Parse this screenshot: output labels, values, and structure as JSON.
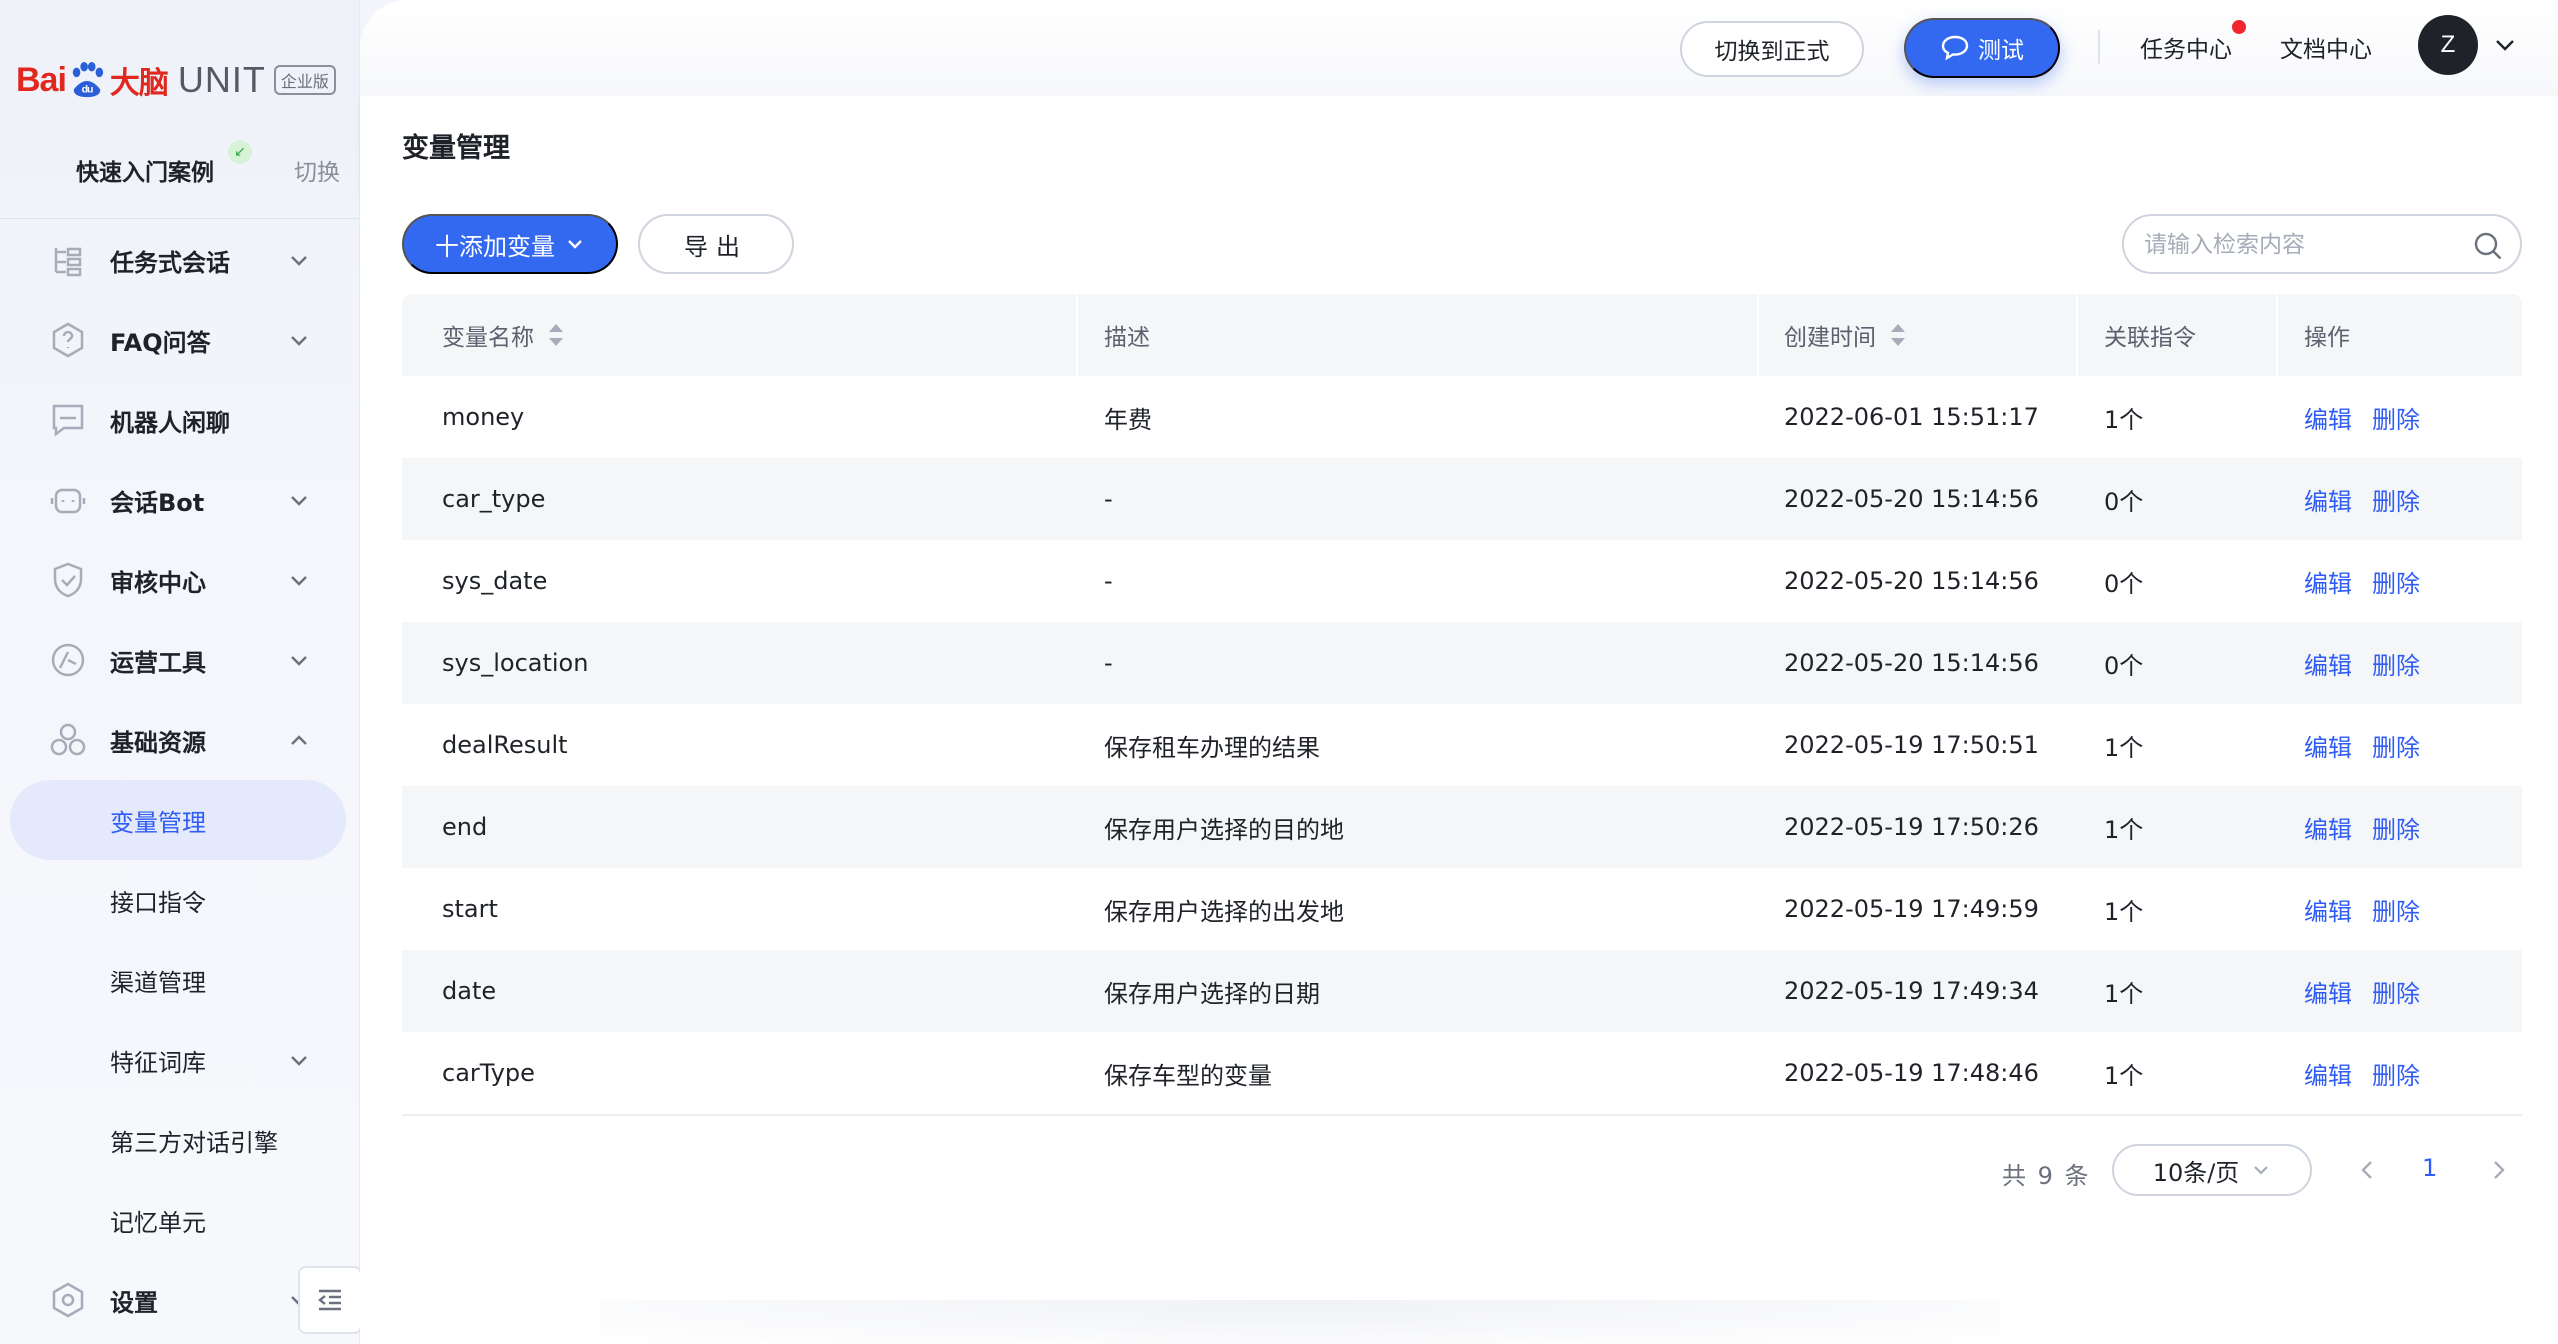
{
  "brand": {
    "baidu": "Bai",
    "du": "du",
    "dana": "大脑",
    "unit": "UNIT",
    "edition": "企业版"
  },
  "project": {
    "name": "快速入门案例",
    "switch_label": "切换"
  },
  "sidebar": {
    "items": [
      {
        "label": "任务式会话",
        "icon": "task-dialog-icon",
        "chevron": "down"
      },
      {
        "label": "FAQ问答",
        "icon": "faq-icon",
        "chevron": "down"
      },
      {
        "label": "机器人闲聊",
        "icon": "chat-icon",
        "chevron": ""
      },
      {
        "label": "会话Bot",
        "icon": "bot-icon",
        "chevron": "down"
      },
      {
        "label": "审核中心",
        "icon": "shield-icon",
        "chevron": "down"
      },
      {
        "label": "运营工具",
        "icon": "operations-icon",
        "chevron": "down"
      },
      {
        "label": "基础资源",
        "icon": "resources-icon",
        "chevron": "up"
      },
      {
        "label": "变量管理",
        "sub": true,
        "active": true
      },
      {
        "label": "接口指令",
        "sub": true
      },
      {
        "label": "渠道管理",
        "sub": true
      },
      {
        "label": "特征词库",
        "sub": true,
        "chevron": "down"
      },
      {
        "label": "第三方对话引擎",
        "sub": true
      },
      {
        "label": "记忆单元",
        "sub": true
      },
      {
        "label": "设置",
        "icon": "settings-icon",
        "chevron": "down"
      }
    ]
  },
  "header": {
    "switch_label": "切换到正式",
    "test_label": "测试",
    "task_center": "任务中心",
    "doc_center": "文档中心",
    "avatar_letter": "Z"
  },
  "page": {
    "title": "变量管理"
  },
  "toolbar": {
    "add_label": "十添加变量",
    "export_label": "导出",
    "search_placeholder": "请输入检索内容"
  },
  "table": {
    "columns": [
      "变量名称",
      "描述",
      "创建时间",
      "关联指令",
      "操作"
    ],
    "rows": [
      {
        "name": "money",
        "desc": "年费",
        "created": "2022-06-01 15:51:17",
        "linked": "1个"
      },
      {
        "name": "car_type",
        "desc": "-",
        "created": "2022-05-20 15:14:56",
        "linked": "0个"
      },
      {
        "name": "sys_date",
        "desc": "-",
        "created": "2022-05-20 15:14:56",
        "linked": "0个"
      },
      {
        "name": "sys_location",
        "desc": "-",
        "created": "2022-05-20 15:14:56",
        "linked": "0个"
      },
      {
        "name": "dealResult",
        "desc": "保存租车办理的结果",
        "created": "2022-05-19 17:50:51",
        "linked": "1个"
      },
      {
        "name": "end",
        "desc": "保存用户选择的目的地",
        "created": "2022-05-19 17:50:26",
        "linked": "1个"
      },
      {
        "name": "start",
        "desc": "保存用户选择的出发地",
        "created": "2022-05-19 17:49:59",
        "linked": "1个"
      },
      {
        "name": "date",
        "desc": "保存用户选择的日期",
        "created": "2022-05-19 17:49:34",
        "linked": "1个"
      },
      {
        "name": "carType",
        "desc": "保存车型的变量",
        "created": "2022-05-19 17:48:46",
        "linked": "1个"
      }
    ],
    "actions": {
      "edit": "编辑",
      "delete": "删除"
    }
  },
  "pagination": {
    "total": "共 9 条",
    "page_size": "10条/页",
    "current_page": "1"
  },
  "colors": {
    "accent": "#3369f0",
    "link": "#2f5cf5",
    "brand_red": "#e0281e",
    "notification_dot": "#f2262f"
  }
}
